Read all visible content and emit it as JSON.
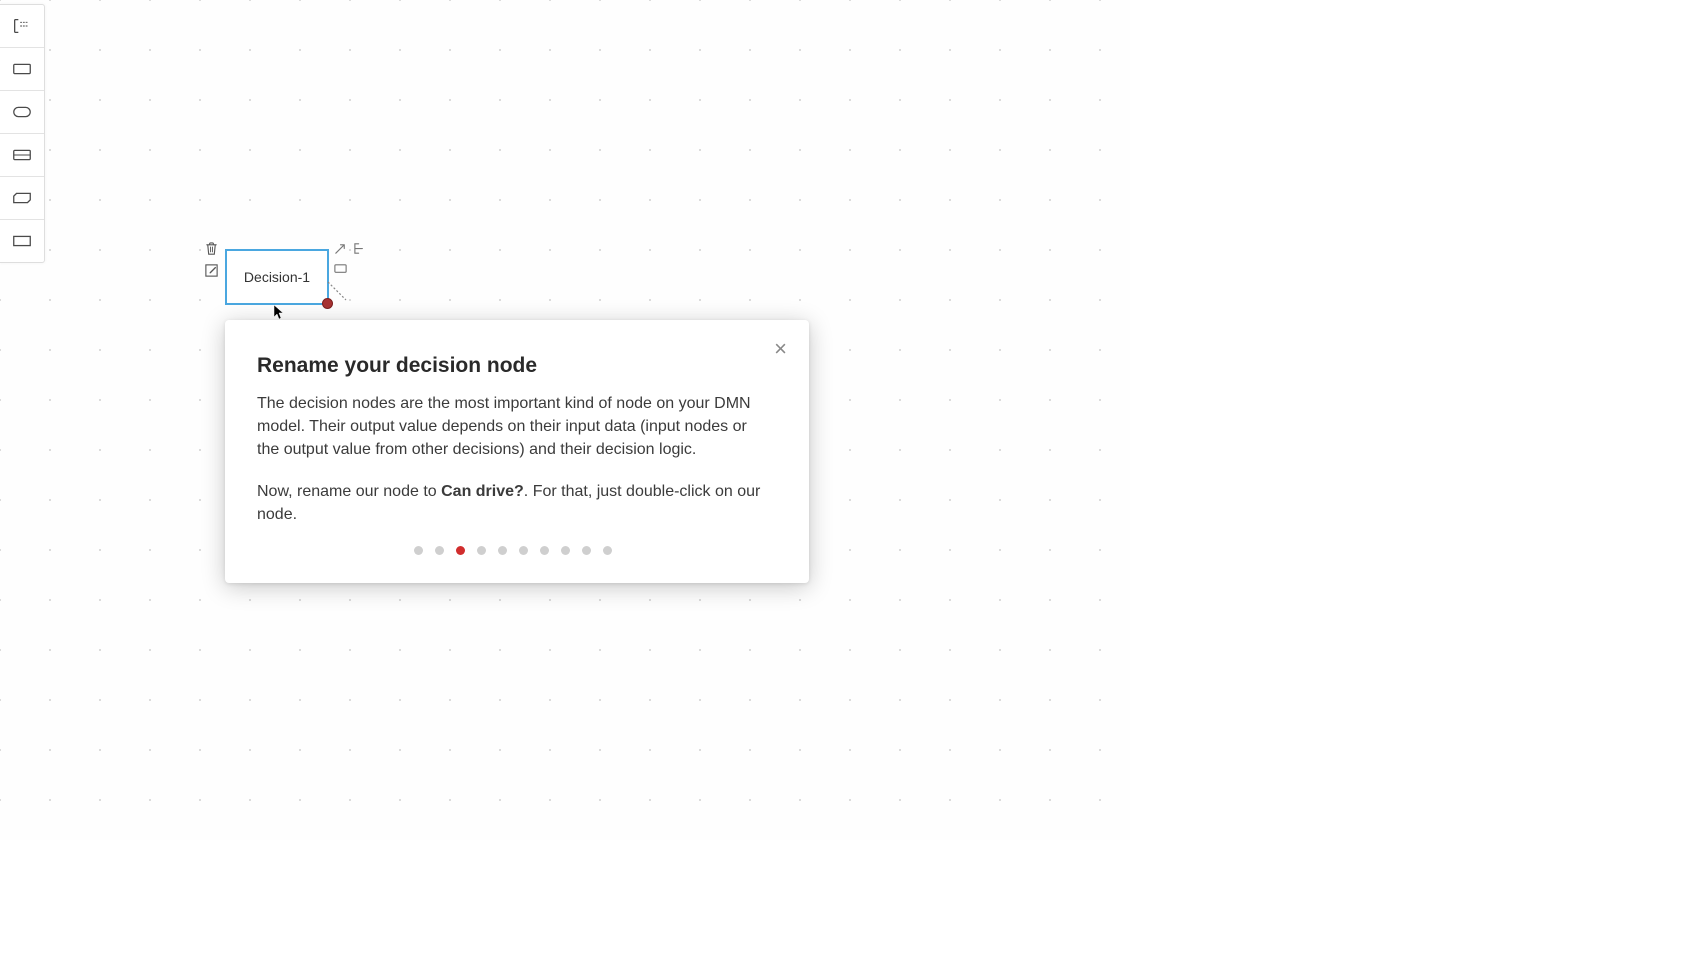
{
  "toolbar": {
    "items": [
      {
        "name": "annotation-tool"
      },
      {
        "name": "decision-shape-tool"
      },
      {
        "name": "input-data-shape-tool"
      },
      {
        "name": "knowledge-source-shape-tool"
      },
      {
        "name": "bkm-shape-tool"
      },
      {
        "name": "decision-service-shape-tool"
      }
    ]
  },
  "canvas": {
    "node": {
      "label": "Decision-1"
    },
    "context_tools": [
      "trash-icon",
      "edit-icon",
      "properties-icon",
      "connect-icon",
      "link-icon"
    ]
  },
  "tutorial": {
    "title": "Rename your decision node",
    "para1": "The decision nodes are the most important kind of node on your DMN model. Their output value depends on their input data (input nodes or the output value from other decisions) and their decision logic.",
    "para2_prefix": "Now, rename our node to ",
    "para2_bold": "Can drive?",
    "para2_suffix": ". For that, just double-click on our node.",
    "close_glyph": "×",
    "steps_total": 10,
    "step_active_index": 2
  },
  "colors": {
    "accent_red": "#d12d2d",
    "selection_blue": "#4aa7e0"
  }
}
